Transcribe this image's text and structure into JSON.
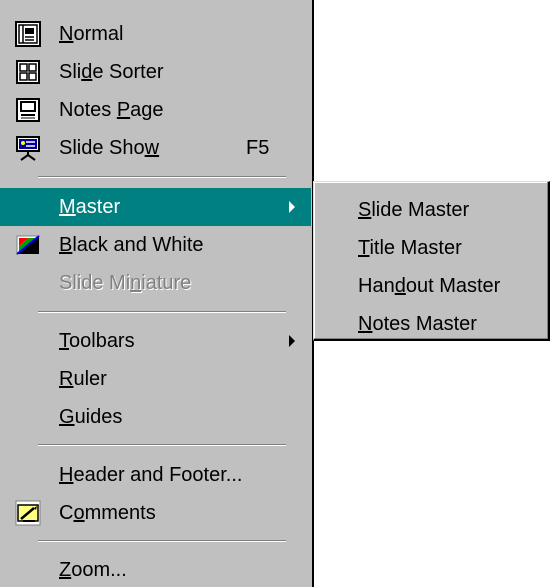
{
  "menu": {
    "items": [
      {
        "pre": "",
        "hot": "N",
        "post": "ormal",
        "accel": "",
        "icon": "normal-view-icon"
      },
      {
        "pre": "Sli",
        "hot": "d",
        "post": "e Sorter",
        "accel": "",
        "icon": "slide-sorter-icon"
      },
      {
        "pre": "Notes ",
        "hot": "P",
        "post": "age",
        "accel": "",
        "icon": "notes-page-icon"
      },
      {
        "pre": "Slide Sho",
        "hot": "w",
        "post": "",
        "accel": "F5",
        "icon": "slide-show-icon"
      },
      {
        "pre": "",
        "hot": "M",
        "post": "aster",
        "accel": "",
        "icon": ""
      },
      {
        "pre": "",
        "hot": "B",
        "post": "lack and White",
        "accel": "",
        "icon": "black-and-white-icon"
      },
      {
        "pre": "Slide Mi",
        "hot": "n",
        "post": "iature",
        "accel": "",
        "icon": ""
      },
      {
        "pre": "",
        "hot": "T",
        "post": "oolbars",
        "accel": "",
        "icon": ""
      },
      {
        "pre": "",
        "hot": "R",
        "post": "uler",
        "accel": "",
        "icon": ""
      },
      {
        "pre": "",
        "hot": "G",
        "post": "uides",
        "accel": "",
        "icon": ""
      },
      {
        "pre": "",
        "hot": "H",
        "post": "eader and Footer...",
        "accel": "",
        "icon": ""
      },
      {
        "pre": "C",
        "hot": "o",
        "post": "mments",
        "accel": "",
        "icon": "comments-icon"
      },
      {
        "pre": "",
        "hot": "Z",
        "post": "oom...",
        "accel": "",
        "icon": ""
      }
    ]
  },
  "submenu": {
    "items": [
      {
        "pre": "",
        "hot": "S",
        "post": "lide Master"
      },
      {
        "pre": "",
        "hot": "T",
        "post": "itle Master"
      },
      {
        "pre": "Han",
        "hot": "d",
        "post": "out Master"
      },
      {
        "pre": "",
        "hot": "N",
        "post": "otes Master"
      }
    ]
  },
  "colors": {
    "menu_bg": "#c0c0c0",
    "highlight_bg": "#008080",
    "highlight_text": "#ffffff",
    "disabled_text": "#808080"
  }
}
